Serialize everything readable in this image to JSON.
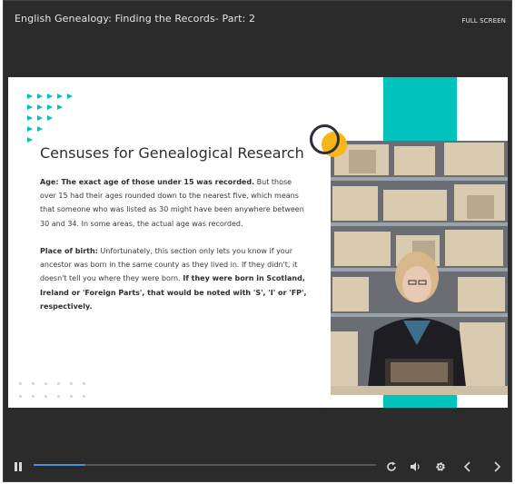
{
  "header": {
    "title": "English Genealogy: Finding the Records- Part: 2",
    "fullscreen_label": "FULL SCREEN"
  },
  "slide": {
    "heading": "Censuses for Genealogical Research",
    "paragraph1": {
      "bold": "Age: The exact age of those under 15 was recorded.",
      "text": " But those over 15 had their ages rounded down to the nearest five, which means that someone who was listed as 30 might have been anywhere between 30 and 34. In some areas, the actual age was recorded."
    },
    "paragraph2": {
      "bold1": "Place of birth:",
      "text": " Unfortunately, this section only lets you know if your ancestor was born in the same county as they lived in. If they didn't, it doesn't tell you where they were born.",
      "bold2": " If they were born in Scotland, Ireland or 'Foreign Parts', that would be noted with 'S', 'I' or 'FP', respectively."
    },
    "colors": {
      "accent_teal": "#00c3be",
      "accent_orange": "#f8b617",
      "ring": "#2b2f38"
    }
  },
  "controls": {
    "progress": 0.15,
    "icons": [
      "pause-icon",
      "replay-icon",
      "volume-icon",
      "settings-icon",
      "previous-icon",
      "next-icon"
    ]
  }
}
